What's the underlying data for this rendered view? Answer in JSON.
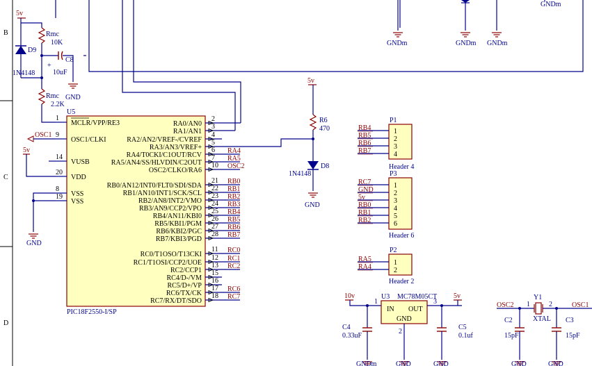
{
  "border_zones": [
    "B",
    "C",
    "D"
  ],
  "power": {
    "v5": "5v",
    "v10": "10v",
    "gnd": "GND",
    "gndm": "GNDm"
  },
  "parts": {
    "rmc_top": {
      "name": "Rmc",
      "value": "10K"
    },
    "d9": {
      "name": "D9",
      "value": "1N4148"
    },
    "c8": {
      "name": "C8",
      "value": "10uF"
    },
    "rmc_bot": {
      "name": "Rmc",
      "value": "2.2K"
    },
    "u5": {
      "name": "U5",
      "value": "PIC18F2550-I/SP"
    },
    "r6": {
      "name": "R6",
      "value": "470"
    },
    "d8": {
      "name": "D8",
      "value": "1N4148"
    },
    "p1": {
      "name": "P1",
      "value": "Header 4"
    },
    "p3": {
      "name": "P3",
      "value": "Header 6"
    },
    "p2": {
      "name": "P2",
      "value": "Header 2"
    },
    "u3": {
      "name": "U3",
      "value": "MC78M05CT",
      "in": "IN",
      "out": "OUT",
      "gnd": "GND",
      "pin_in": "1",
      "pin_out": "3",
      "pin_gnd": "2"
    },
    "c4": {
      "name": "C4",
      "value": "0.33uF"
    },
    "c5": {
      "name": "C5",
      "value": "0.1uf"
    },
    "y1": {
      "name": "Y1",
      "value": "XTAL",
      "pin1": "1",
      "pin2": "2"
    },
    "c2": {
      "name": "C2",
      "value": "15pF"
    },
    "c3": {
      "name": "C3",
      "value": "15pF"
    }
  },
  "u5_left_pins": [
    {
      "num": "1",
      "name": "MCLR/VPP/RE3"
    },
    {
      "num": "9",
      "name": "OSC1/CLKI"
    },
    {
      "num": "14",
      "name": "VUSB"
    },
    {
      "num": "20",
      "name": "VDD"
    },
    {
      "num": "8",
      "name": "VSS"
    },
    {
      "num": "19",
      "name": "VSS"
    }
  ],
  "u5_right_pins": [
    {
      "num": "2",
      "name": "RA0/AN0",
      "net": ""
    },
    {
      "num": "3",
      "name": "RA1/AN1",
      "net": ""
    },
    {
      "num": "4",
      "name": "RA2/AN2/VREF-/CVREF",
      "net": ""
    },
    {
      "num": "5",
      "name": "RA3/AN3/VREF+",
      "net": ""
    },
    {
      "num": "6",
      "name": "RA4/T0CKI/C1OUT/RCV",
      "net": "RA4"
    },
    {
      "num": "7",
      "name": "RA5/AN4/SS/HLVDIN/C2OUT",
      "net": "RA5"
    },
    {
      "num": "10",
      "name": "OSC2/CLKO/RA6",
      "net": "OSC2"
    },
    {
      "num": "21",
      "name": "RB0/AN12/INT0/FLT0/SDI/SDA",
      "net": "RB0"
    },
    {
      "num": "22",
      "name": "RB1/AN10/INT1/SCK/SCL",
      "net": "RB1"
    },
    {
      "num": "23",
      "name": "RB2/AN8/INT2/VMO",
      "net": "RB2"
    },
    {
      "num": "24",
      "name": "RB3/AN9/CCP2/VPO",
      "net": "RB3"
    },
    {
      "num": "25",
      "name": "RB4/AN11/KBI0",
      "net": "RB4"
    },
    {
      "num": "26",
      "name": "RB5/KBI1/PGM",
      "net": "RB5"
    },
    {
      "num": "27",
      "name": "RB6/KBI2/PGC",
      "net": "RB6"
    },
    {
      "num": "28",
      "name": "RB7/KBI3/PGD",
      "net": "RB7"
    },
    {
      "num": "11",
      "name": "RC0/T1OSO/T13CKI",
      "net": "RC0"
    },
    {
      "num": "12",
      "name": "RC1/T1OSI/CCP2/UOE",
      "net": "RC1"
    },
    {
      "num": "13",
      "name": "RC2/CCP1",
      "net": "RC2"
    },
    {
      "num": "15",
      "name": "RC4/D-/VM",
      "net": ""
    },
    {
      "num": "16",
      "name": "RC5/D+/VP",
      "net": ""
    },
    {
      "num": "17",
      "name": "RC6/TX/CK",
      "net": "RC6"
    },
    {
      "num": "18",
      "name": "RC7/RX/DT/SDO",
      "net": "RC7"
    }
  ],
  "osc1_net": "OSC1",
  "p1_pins": [
    {
      "num": "1",
      "net": "RB4"
    },
    {
      "num": "2",
      "net": "RB5"
    },
    {
      "num": "3",
      "net": "RB6"
    },
    {
      "num": "4",
      "net": "RB7"
    }
  ],
  "p3_pins": [
    {
      "num": "1",
      "net": "RC7"
    },
    {
      "num": "2",
      "net": "GND"
    },
    {
      "num": "3",
      "net": "5v"
    },
    {
      "num": "4",
      "net": "RB0"
    },
    {
      "num": "5",
      "net": "RB1"
    },
    {
      "num": "6",
      "net": "RB2"
    }
  ],
  "p2_pins": [
    {
      "num": "1",
      "net": "RA5"
    },
    {
      "num": "2",
      "net": "RA4"
    }
  ],
  "osc_nets": {
    "left": "OSC2",
    "right": "OSC1"
  }
}
